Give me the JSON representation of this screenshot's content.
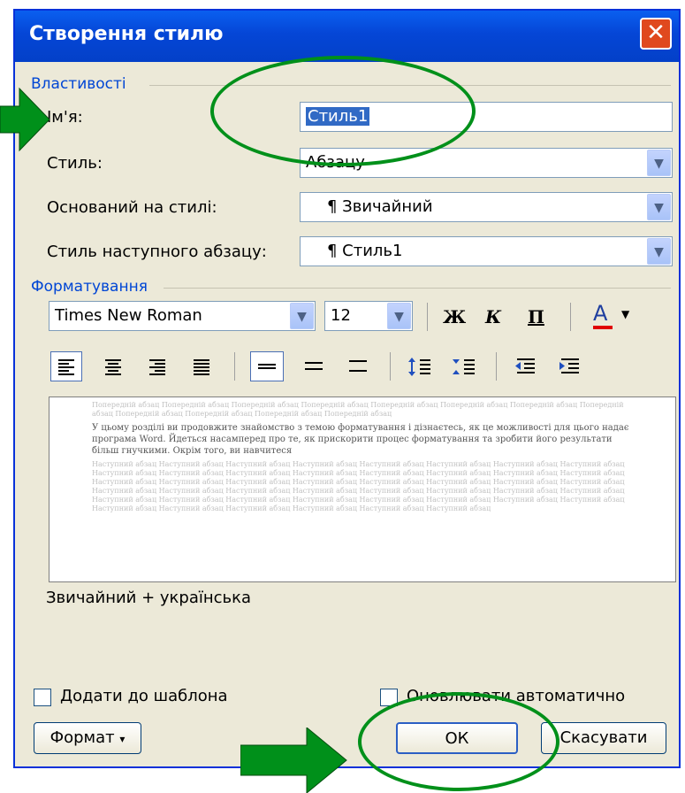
{
  "window": {
    "title": "Створення стилю",
    "close_glyph": "✕"
  },
  "properties": {
    "section_title": "Властивості",
    "name_label": "Ім'я:",
    "name_value": "Стиль1",
    "style_type_label": "Стиль:",
    "style_type_value": "Абзацу",
    "based_on_label": "Оснований на стилі:",
    "based_on_value": "¶ Звичайний",
    "next_style_label": "Стиль наступного абзацу:",
    "next_style_value": "¶ Стиль1"
  },
  "formatting": {
    "section_title": "Форматування",
    "font_name": "Times New Roman",
    "font_size": "12",
    "bold": "Ж",
    "italic": "К",
    "underline": "П",
    "font_color_glyph": "A",
    "font_color": "#e00000"
  },
  "preview": {
    "prev_paragraph": "Попередній абзац Попередній абзац Попередній абзац Попередній абзац Попередній абзац Попередній абзац Попередній абзац Попередній абзац Попередній абзац Попередній абзац Попередній абзац Попередній абзац",
    "sample_text": "У цьому розділі ви продовжите знайомство з темою форматування і дізнаєтесь, як це можливості для цього надає програма Word. Йдеться насамперед про те, як прискорити процес форматування та зробити його результати більш гнучкими. Окрім того, ви навчитеся",
    "next_paragraph": "Наступний абзац Наступний абзац Наступний абзац Наступний абзац Наступний абзац Наступний абзац Наступний абзац Наступний абзац Наступний абзац Наступний абзац Наступний абзац Наступний абзац Наступний абзац Наступний абзац Наступний абзац Наступний абзац Наступний абзац Наступний абзац Наступний абзац Наступний абзац Наступний абзац Наступний абзац Наступний абзац Наступний абзац Наступний абзац Наступний абзац Наступний абзац Наступний абзац Наступний абзац Наступний абзац Наступний абзац Наступний абзац Наступний абзац Наступний абзац Наступний абзац Наступний абзац Наступний абзац Наступний абзац Наступний абзац Наступний абзац Наступний абзац Наступний абзац Наступний абзац Наступний абзац Наступний абзац Наступний абзац"
  },
  "description": "Звичайний + українська",
  "options": {
    "add_to_template": "Додати до шаблона",
    "auto_update": "Оновлювати автоматично"
  },
  "buttons": {
    "format": "Формат",
    "format_arrow": "▾",
    "ok": "ОК",
    "cancel": "Скасувати"
  },
  "colors": {
    "annotation_green": "#00901a",
    "title_blue": "#0046d5"
  }
}
